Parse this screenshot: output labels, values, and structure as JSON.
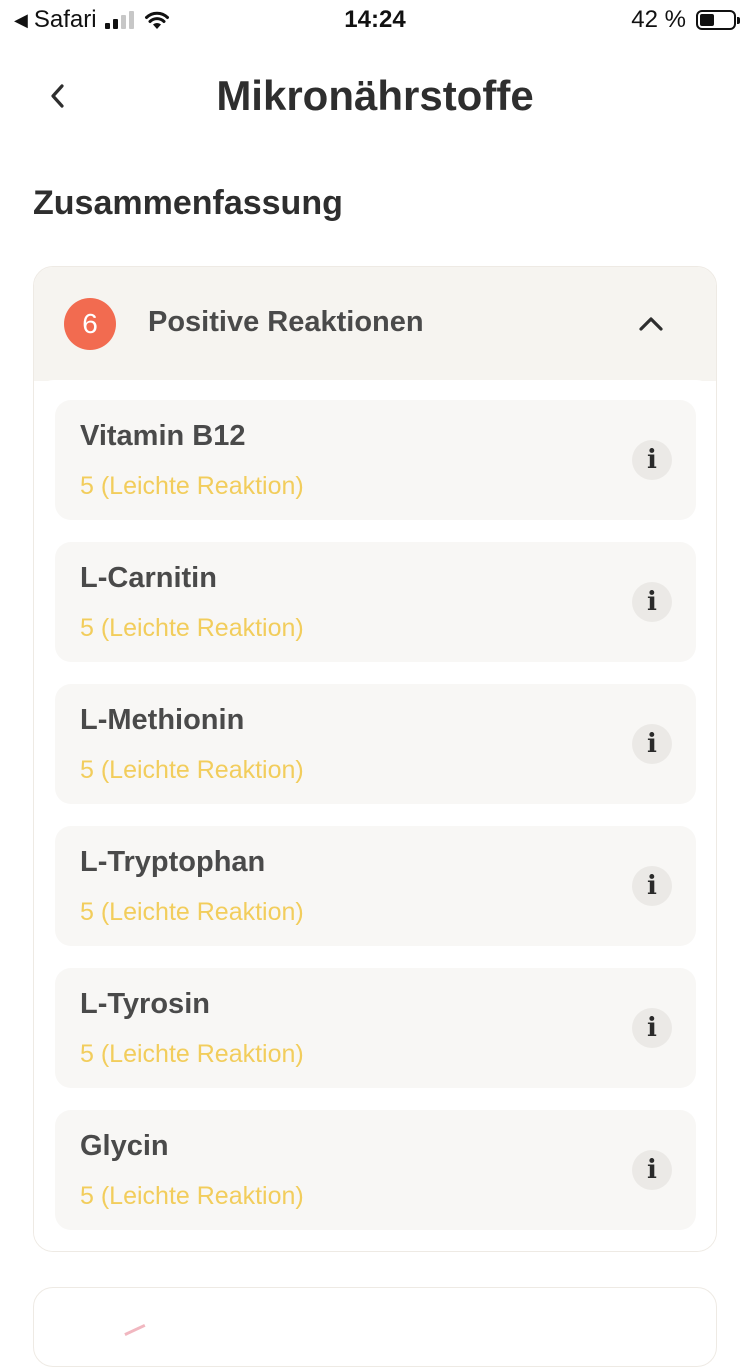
{
  "status_bar": {
    "back_app": "Safari",
    "time": "14:24",
    "battery": "42 %",
    "battery_level": 0.42
  },
  "header": {
    "title": "Mikronährstoffe"
  },
  "summary": {
    "section_title": "Zusammenfassung",
    "group": {
      "count": "6",
      "title": "Positive Reaktionen",
      "expanded": true,
      "items": [
        {
          "name": "Vitamin B12",
          "status": "5 (Leichte Reaktion)"
        },
        {
          "name": "L-Carnitin",
          "status": "5 (Leichte Reaktion)"
        },
        {
          "name": "L-Methionin",
          "status": "5 (Leichte Reaktion)"
        },
        {
          "name": "L-Tryptophan",
          "status": "5 (Leichte Reaktion)"
        },
        {
          "name": "L-Tyrosin",
          "status": "5 (Leichte Reaktion)"
        },
        {
          "name": "Glycin",
          "status": "5 (Leichte Reaktion)"
        }
      ]
    }
  },
  "colors": {
    "badge": "#f26b50",
    "status_text": "#f2cd5c",
    "header_bg": "#f6f4f0"
  },
  "icons": {
    "back": "chevron-left-icon",
    "collapse": "chevron-up-icon",
    "info": "info-icon"
  }
}
